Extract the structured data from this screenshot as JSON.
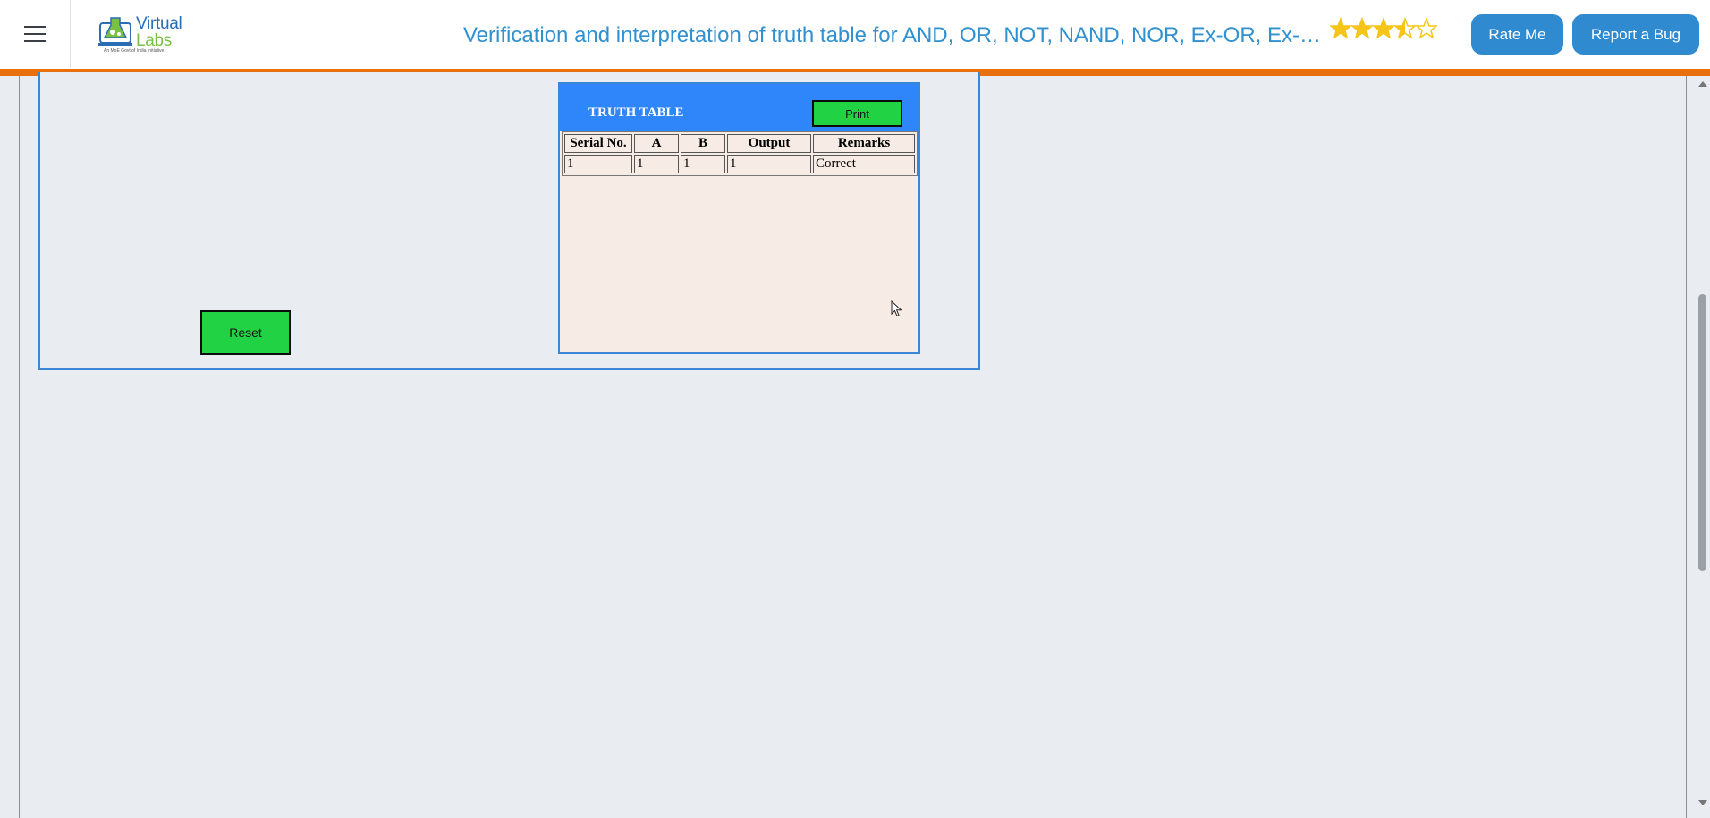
{
  "header": {
    "title": "Verification and interpretation of truth table for AND, OR, NOT, NAND, NOR, Ex-OR, Ex-NOR gates",
    "logo": {
      "line1": "Virtual",
      "line2": "Labs",
      "tagline": "An MoE Govt of India Initiative"
    },
    "rating": {
      "value": 3.5,
      "max": 5,
      "star_color": "#f5c518"
    },
    "rate_label": "Rate Me",
    "bug_label": "Report a Bug",
    "menu_icon": "hamburger-menu-icon",
    "accent_color": "#e9700f",
    "button_color": "#2f8ad0"
  },
  "simulator": {
    "reset_label": "Reset",
    "truth_table": {
      "title": "TRUTH TABLE",
      "print_label": "Print",
      "columns": [
        "Serial No.",
        "A",
        "B",
        "Output",
        "Remarks"
      ],
      "rows": [
        [
          "1",
          "1",
          "1",
          "1",
          "Correct"
        ]
      ]
    },
    "button_color": "#22d245",
    "header_color": "#2f86fb"
  }
}
